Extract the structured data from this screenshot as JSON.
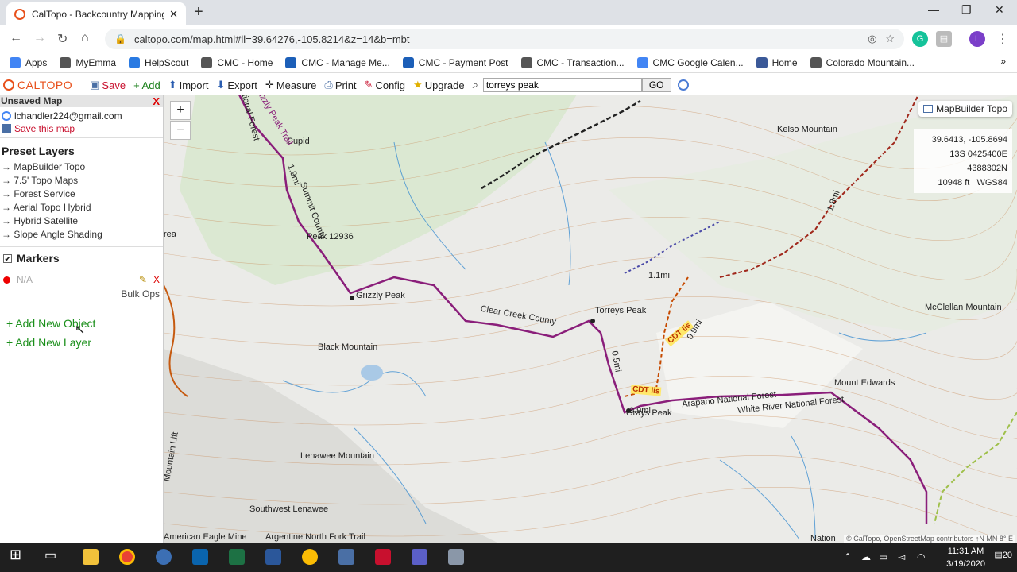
{
  "browser": {
    "tab_title": "CalTopo - Backcountry Mapping",
    "url": "caltopo.com/map.html#ll=39.64276,-105.8214&z=14&b=mbt",
    "profile_initial": "L",
    "bookmarks": [
      {
        "label": "Apps",
        "color": "#4285f4"
      },
      {
        "label": "MyEmma",
        "color": "#555555"
      },
      {
        "label": "HelpScout",
        "color": "#2a7ae2"
      },
      {
        "label": "CMC - Home",
        "color": "#555555"
      },
      {
        "label": "CMC - Manage Me...",
        "color": "#1c5fb8"
      },
      {
        "label": "CMC - Payment Post",
        "color": "#1c5fb8"
      },
      {
        "label": "CMC - Transaction...",
        "color": "#555555"
      },
      {
        "label": "CMC Google Calen...",
        "color": "#4285f4"
      },
      {
        "label": "Home",
        "color": "#3b5998"
      },
      {
        "label": "Colorado Mountain...",
        "color": "#555555"
      }
    ],
    "bookmarks_more": "»"
  },
  "toolbar": {
    "logo": "CALTOPO",
    "save": "Save",
    "add": "+ Add",
    "import": "Import",
    "export": "Export",
    "measure": "Measure",
    "print": "Print",
    "config": "Config",
    "upgrade": "Upgrade",
    "search_value": "torreys peak",
    "go": "GO"
  },
  "panel": {
    "header": "Unsaved Map",
    "close": "X",
    "account": "lchandler224@gmail.com",
    "save_map": "Save this map",
    "preset_title": "Preset Layers",
    "layers": [
      "→ MapBuilder Topo",
      "→ 7.5' Topo Maps",
      "→ Forest Service",
      "→ Aerial Topo Hybrid",
      "→ Hybrid Satellite",
      "→ Slope Angle Shading"
    ],
    "markers_title": "Markers",
    "marker_name": "N/A",
    "marker_delete": "X",
    "bulk_ops": "Bulk Ops",
    "add_object": "+ Add New Object",
    "add_layer": "+ Add New Layer"
  },
  "map": {
    "zoom_in": "+",
    "zoom_out": "−",
    "layer_button": "MapBuilder Topo",
    "coords": {
      "latlon": "39.6413, -105.8694",
      "utm": "13S 0425400E 4388302N",
      "elevation": "10948 ft",
      "datum": "WGS84"
    },
    "labels": {
      "kelso": "Kelso Mountain",
      "cupid": "Cupid",
      "peak12936": "Peak 12936",
      "grizzly": "Grizzly Peak",
      "clearcreek": "Clear Creek County",
      "torreys": "Torreys Peak",
      "mcclellan": "McClellan Mountain",
      "black": "Black Mountain",
      "grays": "Grays Peak",
      "arapaho": "Arapaho National Forest",
      "whiteriver": "White River National Forest",
      "edwards": "Mount Edwards",
      "lenawee": "Lenawee Mountain",
      "swlenawee": "Southwest Lenawee",
      "argentine": "Argentine North Fork Trail",
      "eagle": "American Eagle Mine",
      "summit": "Summit County",
      "grizzlytrail": "Grizzly Peak Trail",
      "nationalforest": "National Forest",
      "mountainlift": "Mountain Lift",
      "nation": "Nation",
      "area": "rea",
      "dist1": "1.9mi",
      "dist2": "1.1mi",
      "dist3": "0.9mi",
      "dist4": "0.5mi",
      "dist5": "0.9mi",
      "dist6": "1.8mi",
      "cdt1": "CDT lis",
      "cdt2": "CDT lis"
    },
    "attribution": "© CalTopo, OpenStreetMap contributors  ↑N MN 8° E"
  },
  "taskbar": {
    "time": "11:31 AM",
    "date": "3/19/2020",
    "notifications": "20"
  }
}
